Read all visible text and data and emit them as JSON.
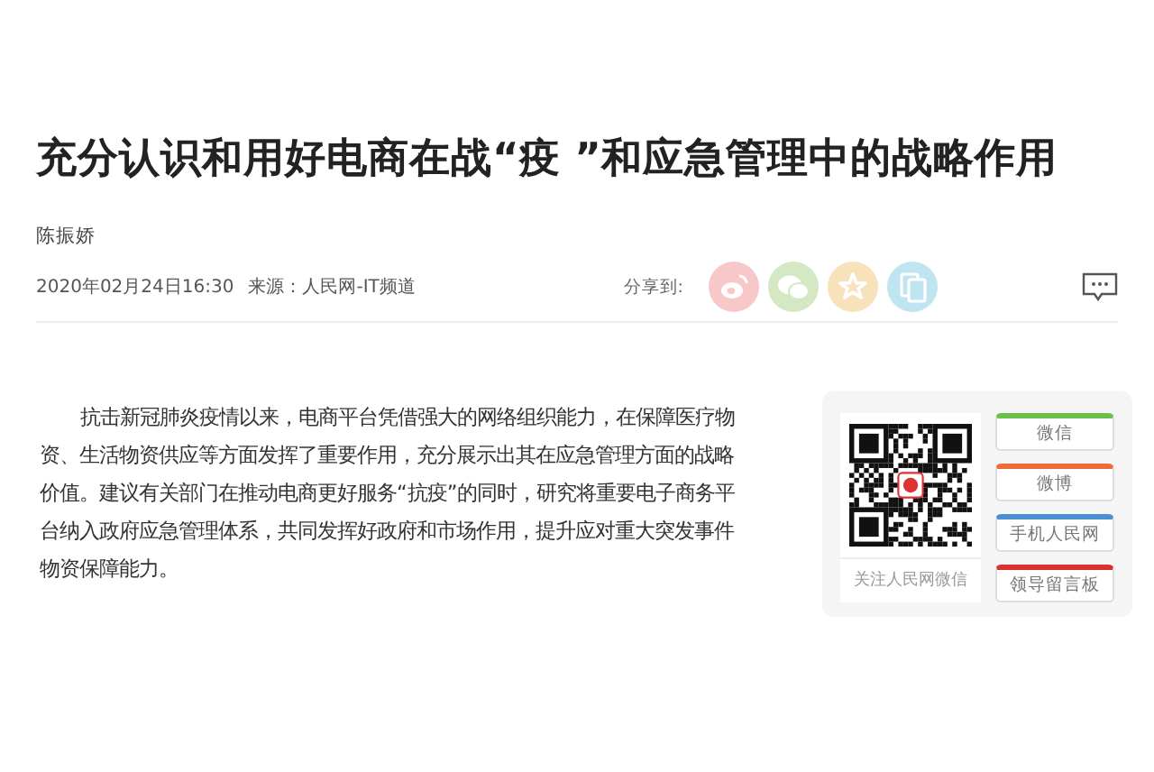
{
  "article": {
    "title": "充分认识和用好电商在战“疫 ”和应急管理中的战略作用",
    "author": "陈振娇",
    "date": "2020年02月24日16:30",
    "source": "来源：人民网-IT频道"
  },
  "share": {
    "label": "分享到:",
    "targets": [
      {
        "kind": "weibo",
        "color": "#f8c8c8"
      },
      {
        "kind": "wechat",
        "color": "#d4e8c4"
      },
      {
        "kind": "favorite",
        "color": "#f8e2bc"
      },
      {
        "kind": "copy",
        "color": "#bfe5f0"
      }
    ]
  },
  "body": {
    "paragraph": "抗击新冠肺炎疫情以来，电商平台凭借强大的网络组织能力，在保障医疗物资、生活物资供应等方面发挥了重要作用，充分展示出其在应急管理方面的战略价值。建议有关部门在推动电商更好服务“抗疫”的同时，研究将重要电子商务平台纳入政府应急管理体系，共同发挥好政府和市场作用，提升应对重大突发事件物资保障能力。"
  },
  "follow_panel": {
    "qr_caption": "关注人民网微信",
    "links": [
      {
        "label": "微信",
        "color": "#6cc04a"
      },
      {
        "label": "微博",
        "color": "#f06a3a"
      },
      {
        "label": "手机人民网",
        "color": "#4a8fd0"
      },
      {
        "label": "领导留言板",
        "color": "#d93030"
      }
    ]
  }
}
